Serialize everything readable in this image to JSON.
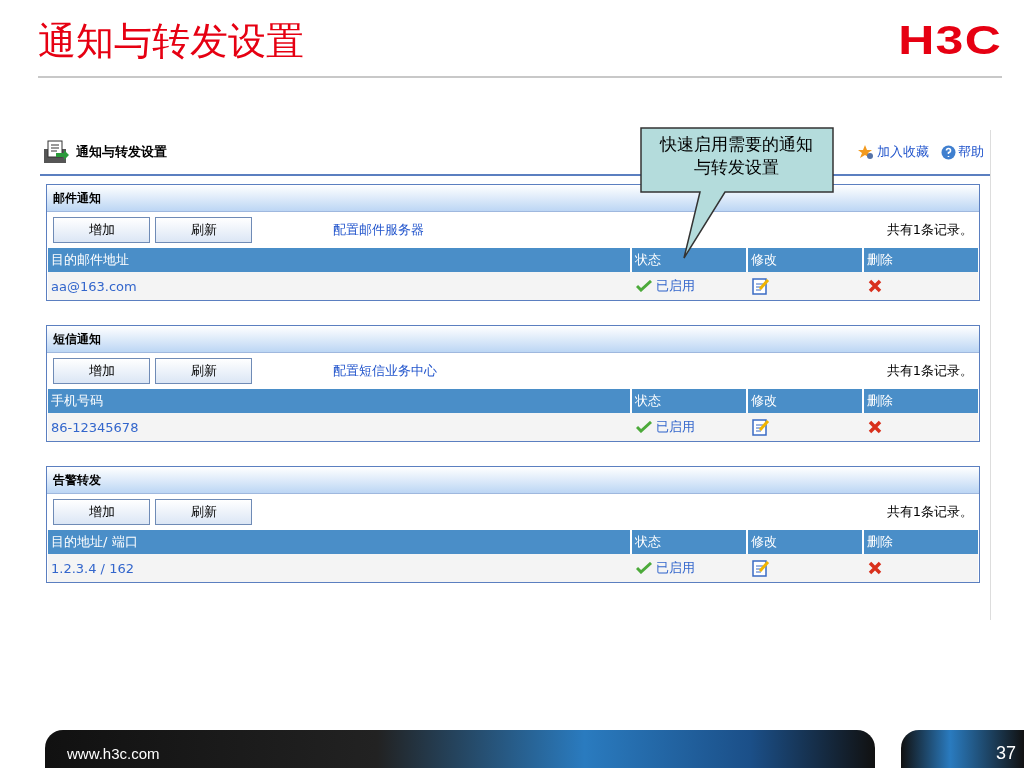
{
  "slide": {
    "title": "通知与转发设置",
    "logo": "H3C"
  },
  "page": {
    "title": "通知与转发设置",
    "links": [
      {
        "kind": "favorite",
        "label": "加入收藏"
      },
      {
        "kind": "help",
        "label": "帮助"
      }
    ]
  },
  "callout": {
    "text": "快速启用需要的通知与转发设置"
  },
  "sections": [
    {
      "title": "邮件通知",
      "buttons": [
        "增加",
        "刷新"
      ],
      "link": "配置邮件服务器",
      "count": "共有1条记录。",
      "columns": [
        "目的邮件地址",
        "状态",
        "修改",
        "删除"
      ],
      "rows": [
        {
          "target": "aa@163.com",
          "status": "已启用",
          "enabled": true
        }
      ]
    },
    {
      "title": "短信通知",
      "buttons": [
        "增加",
        "刷新"
      ],
      "link": "配置短信业务中心",
      "count": "共有1条记录。",
      "columns": [
        "手机号码",
        "状态",
        "修改",
        "删除"
      ],
      "rows": [
        {
          "target": "86-12345678",
          "status": "已启用",
          "enabled": true
        }
      ]
    },
    {
      "title": "告警转发",
      "buttons": [
        "增加",
        "刷新"
      ],
      "count": "共有1条记录。",
      "columns": [
        "目的地址/ 端口",
        "状态",
        "修改",
        "删除"
      ],
      "rows": [
        {
          "target": "1.2.3.4 / 162",
          "status": "已启用",
          "enabled": true
        }
      ]
    }
  ],
  "footer": {
    "url": "www.h3c.com",
    "page": "37"
  }
}
